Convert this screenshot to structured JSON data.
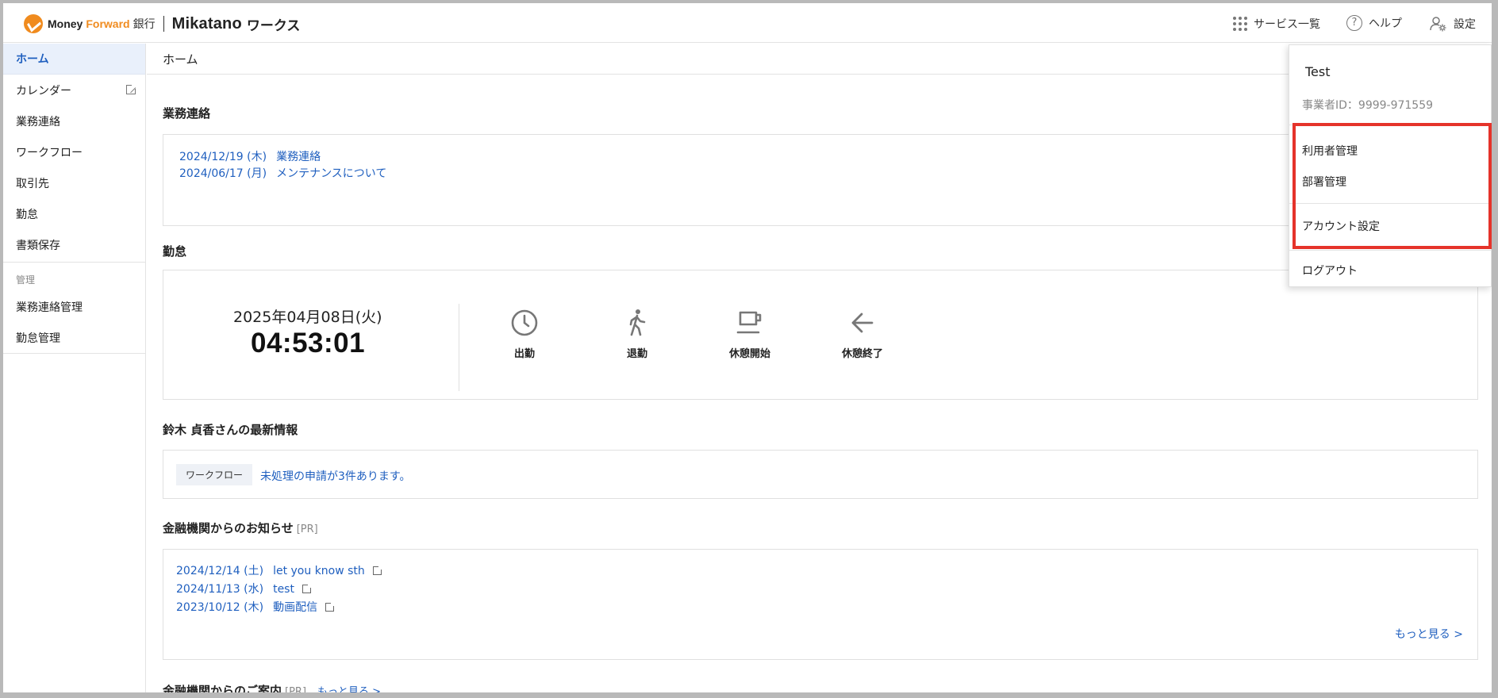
{
  "header": {
    "logo_money": "Money",
    "logo_forward": "Forward",
    "logo_bank": "銀行",
    "logo_mikatano": "Mikatano",
    "logo_works": "ワークス",
    "services_label": "サービス一覧",
    "help_label": "ヘルプ",
    "settings_label": "設定"
  },
  "sidebar": {
    "items": [
      {
        "label": "ホーム"
      },
      {
        "label": "カレンダー"
      },
      {
        "label": "業務連絡"
      },
      {
        "label": "ワークフロー"
      },
      {
        "label": "取引先"
      },
      {
        "label": "勤怠"
      },
      {
        "label": "書類保存"
      }
    ],
    "admin_section_label": "管理",
    "admin_items": [
      {
        "label": "業務連絡管理"
      },
      {
        "label": "勤怠管理"
      }
    ]
  },
  "main": {
    "breadcrumb": "ホーム",
    "business_notice": {
      "title": "業務連絡",
      "items": [
        {
          "date": "2024/12/19 (木)",
          "title": "業務連絡"
        },
        {
          "date": "2024/06/17 (月)",
          "title": "メンテナンスについて"
        }
      ]
    },
    "attendance": {
      "title": "勤怠",
      "date": "2025年04月08日(火)",
      "time": "04:53:01",
      "buttons": [
        {
          "label": "出勤",
          "icon": "clock-icon"
        },
        {
          "label": "退勤",
          "icon": "walking-person-icon"
        },
        {
          "label": "休憩開始",
          "icon": "coffee-cup-icon"
        },
        {
          "label": "休憩終了",
          "icon": "arrow-left-icon"
        }
      ]
    },
    "latest": {
      "title": "鈴木 貞香さんの最新情報",
      "tag": "ワークフロー",
      "text": "未処理の申請が3件あります。"
    },
    "bank_news": {
      "title": "金融機関からのお知らせ",
      "pr": "[PR]",
      "items": [
        {
          "date": "2024/12/14 (土)",
          "title": "let you know sth"
        },
        {
          "date": "2024/11/13 (水)",
          "title": "test"
        },
        {
          "date": "2023/10/12 (木)",
          "title": "動画配信"
        }
      ],
      "more": "もっと見る >"
    },
    "bank_guide": {
      "title": "金融機関からのご案内",
      "pr": "[PR]",
      "more": "もっと見る >"
    }
  },
  "dropdown": {
    "user_name": "Test",
    "business_id": "事業者ID：9999-971559",
    "items": [
      {
        "label": "利用者管理"
      },
      {
        "label": "部署管理"
      },
      {
        "label": "アカウント設定"
      },
      {
        "label": "ログアウト"
      }
    ],
    "highlight_color": "#e5332a"
  },
  "colors": {
    "accent": "#1f5fbf",
    "brand_orange": "#f08b1e"
  }
}
